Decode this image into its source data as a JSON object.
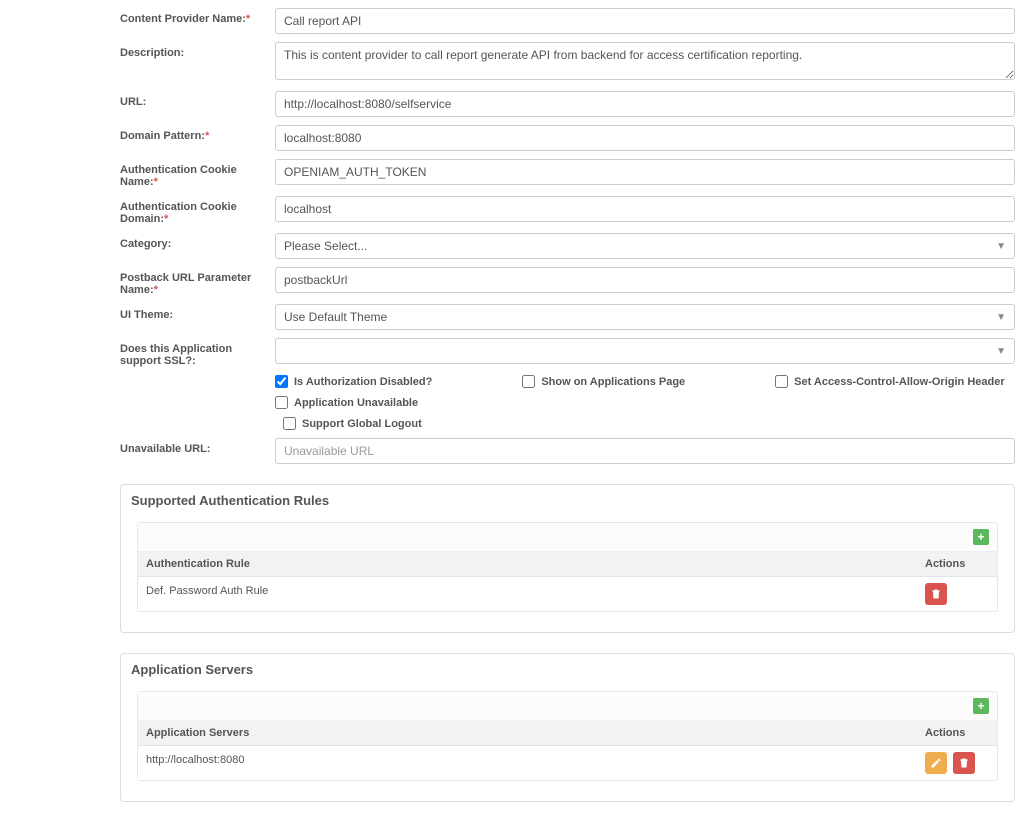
{
  "form": {
    "content_provider_name": {
      "label": "Content Provider Name:",
      "value": "Call report API"
    },
    "description": {
      "label": "Description:",
      "value": "This is content provider to call report generate API from backend for access certification reporting."
    },
    "url": {
      "label": "URL:",
      "value": "http://localhost:8080/selfservice"
    },
    "domain_pattern": {
      "label": "Domain Pattern:",
      "value": "localhost:8080"
    },
    "auth_cookie_name": {
      "label": "Authentication Cookie Name:",
      "value": "OPENIAM_AUTH_TOKEN"
    },
    "auth_cookie_domain": {
      "label": "Authentication Cookie Domain:",
      "value": "localhost"
    },
    "category": {
      "label": "Category:",
      "selected": "Please Select..."
    },
    "postback_url_param": {
      "label": "Postback URL Parameter Name:",
      "value": "postbackUrl"
    },
    "ui_theme": {
      "label": "UI Theme:",
      "selected": "Use Default Theme"
    },
    "ssl_support": {
      "label": "Does this Application support SSL?:",
      "selected": ""
    },
    "unavailable_url": {
      "label": "Unavailable URL:",
      "placeholder": "Unavailable URL",
      "value": ""
    }
  },
  "checkboxes": {
    "is_auth_disabled": {
      "label": "Is Authorization Disabled?",
      "checked": true
    },
    "show_on_apps": {
      "label": "Show on Applications Page",
      "checked": false
    },
    "set_cors": {
      "label": "Set Access-Control-Allow-Origin Header",
      "checked": false
    },
    "app_unavailable": {
      "label": "Application Unavailable",
      "checked": false
    },
    "support_global_logout": {
      "label": "Support Global Logout",
      "checked": false
    }
  },
  "auth_rules": {
    "title": "Supported Authentication Rules",
    "columns": {
      "rule": "Authentication Rule",
      "actions": "Actions"
    },
    "rows": [
      {
        "rule": "Def. Password Auth Rule"
      }
    ]
  },
  "app_servers": {
    "title": "Application Servers",
    "columns": {
      "server": "Application Servers",
      "actions": "Actions"
    },
    "rows": [
      {
        "server": "http://localhost:8080"
      }
    ]
  }
}
